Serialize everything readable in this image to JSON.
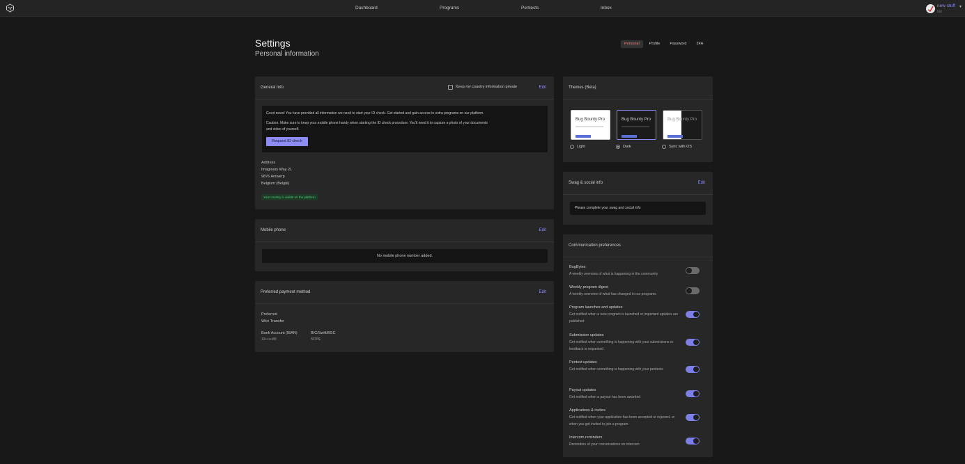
{
  "nav": {
    "items": [
      "Dashboard",
      "Programs",
      "Pentests",
      "Inbox"
    ]
  },
  "user": {
    "name": "new stuff",
    "sub": "ISE",
    "caret": "▾"
  },
  "page": {
    "title": "Settings",
    "subtitle": "Personal information"
  },
  "tabs": [
    {
      "label": "Personal",
      "active": true
    },
    {
      "label": "Profile",
      "active": false
    },
    {
      "label": "Password",
      "active": false
    },
    {
      "label": "2FA",
      "active": false
    }
  ],
  "general": {
    "title": "General Info",
    "private_label": "Keep my country information private",
    "edit": "Edit",
    "notice_line1": "Good news! You have provided all information we need to start your ID check. Get started and gain access to extra programs on our platform.",
    "notice_line2": "Caution: Make sure to keep your mobile phone handy when starting the ID check procedure. You'll need it to capture a photo of your documents",
    "notice_line3": "and video of yourself.",
    "request_button": "Request ID check",
    "address_label": "Address",
    "address_lines": [
      "Imaginary Way 21",
      "9876 Antwerp",
      "Belgium (België)"
    ],
    "visible_badge": "Your country is visible on the platform"
  },
  "mobile": {
    "title": "Mobile phone",
    "edit": "Edit",
    "empty": "No mobile phone number added."
  },
  "payment": {
    "title": "Preferred payment method",
    "edit": "Edit",
    "preferred_label": "Preferred",
    "preferred_value": "Wire Transfer",
    "bank_label": "Bank Account (IBAN)",
    "bank_value": "12••••••89",
    "bic_label": "BIC/Swift/BSC",
    "bic_value": "NOPE"
  },
  "themes": {
    "title": "Themes (Beta)",
    "preview_text": "Bug Bounty Pro",
    "options": [
      {
        "label": "Light",
        "selected": false
      },
      {
        "label": "Dark",
        "selected": true
      },
      {
        "label": "Sync with OS",
        "selected": false
      }
    ]
  },
  "swag": {
    "title": "Swag & social info",
    "edit": "Edit",
    "empty": "Please complete your swag and social info"
  },
  "comm": {
    "title": "Communication preferences",
    "items": [
      {
        "title": "BugBytes",
        "desc": "A weekly overview of what is happening in the community",
        "on": false
      },
      {
        "title": "Weekly program digest",
        "desc": "A weekly overview of what has changed in our programs",
        "on": false
      },
      {
        "title": "Program launches and updates",
        "desc": "Get notified when a new program is launched or important updates are published",
        "on": true
      },
      {
        "title": "Submission updates",
        "desc": "Get notified when something is happening with your submissions or feedback is requested",
        "on": true
      },
      {
        "title": "Pentest updates",
        "desc": "Get notified when something is happening with your pentests",
        "on": true
      },
      {
        "title": "Payout updates",
        "desc": "Get notified when a payout has been awarded",
        "on": true
      },
      {
        "title": "Applications & invites",
        "desc": "Get notified when your application has been accepted or rejected, or when you get invited to join a program",
        "on": true
      },
      {
        "title": "Intercom reminders",
        "desc": "Reminders of your conversations on intercom",
        "on": true
      }
    ]
  }
}
